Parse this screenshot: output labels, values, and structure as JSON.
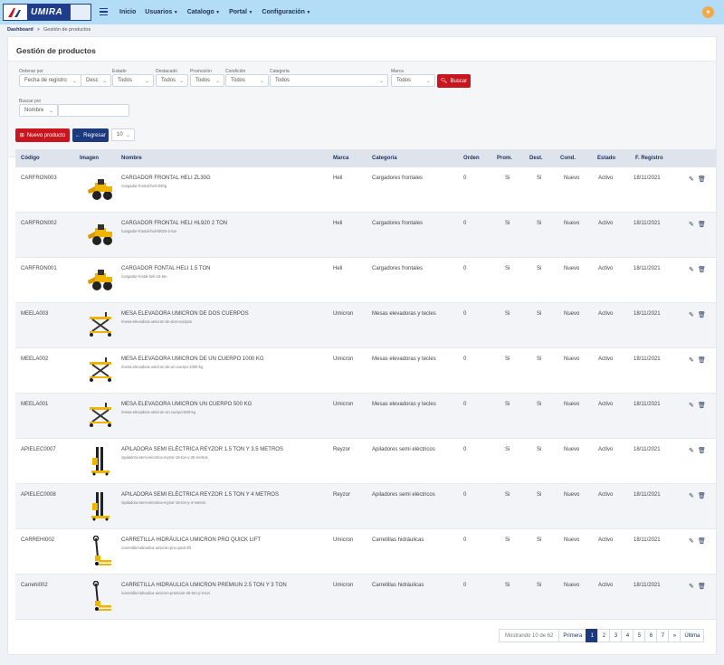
{
  "header": {
    "logo_text": "UMIRA",
    "nav": [
      {
        "label": "Inicio",
        "caret": false
      },
      {
        "label": "Usuarios",
        "caret": true
      },
      {
        "label": "Catalogo",
        "caret": true
      },
      {
        "label": "Portal",
        "caret": true
      },
      {
        "label": "Configuración",
        "caret": true
      }
    ]
  },
  "breadcrumb": {
    "home": "Dashboard",
    "sep": ">",
    "current": "Gestión de productos"
  },
  "page": {
    "title": "Gestión de productos"
  },
  "filters": {
    "ordenar": {
      "label": "Ordenar por",
      "value": "Fecha de registro"
    },
    "dir": {
      "value": "Desc"
    },
    "estado": {
      "label": "Estado",
      "value": "Todos"
    },
    "destacado": {
      "label": "Destacado",
      "value": "Todos"
    },
    "promocion": {
      "label": "Promoción",
      "value": "Todos"
    },
    "condicion": {
      "label": "Condición",
      "value": "Todos"
    },
    "categoria": {
      "label": "Categoria",
      "value": "Todos"
    },
    "marca": {
      "label": "Marca",
      "value": "Todos"
    },
    "buscar_btn": "Buscar",
    "buscar_por": {
      "label": "Buscar por",
      "value": "Nombre"
    },
    "search_value": ""
  },
  "toolbar": {
    "new_label": "Nuevo producto",
    "back_label": "Regresar",
    "page_size": "10"
  },
  "table": {
    "headers": [
      "Código",
      "Imagen",
      "Nombre",
      "Marca",
      "Categoria",
      "Orden",
      "Prom.",
      "Dest.",
      "Cond.",
      "Estado",
      "F. Registro"
    ],
    "rows": [
      {
        "codigo": "CARFRON003",
        "nombre": "CARGADOR FRONTAL HELI ZL30G",
        "slug": "/cargador-frontal-heli-zl30g",
        "marca": "Heli",
        "categoria": "Cargadores frontales",
        "orden": "0",
        "prom": "Si",
        "dest": "Si",
        "cond": "Nuevo",
        "estado": "Activo",
        "fecha": "18/11/2021",
        "img": "loader"
      },
      {
        "codigo": "CARFRON002",
        "nombre": "CARGADOR FRONTAL HELI HL920 2 TON",
        "slug": "/cargador-frontal-heli-hl920-2-ton",
        "marca": "Heli",
        "categoria": "Cargadores frontales",
        "orden": "0",
        "prom": "Si",
        "dest": "Si",
        "cond": "Nuevo",
        "estado": "Activo",
        "fecha": "18/11/2021",
        "img": "loader"
      },
      {
        "codigo": "CARFRON001",
        "nombre": "CARGADOR FONTAL HELI 1.5 TON",
        "slug": "/cargador-fontal-heli-15-ton",
        "marca": "Heli",
        "categoria": "Cargadores frontales",
        "orden": "0",
        "prom": "Si",
        "dest": "Si",
        "cond": "Nuevo",
        "estado": "Activo",
        "fecha": "18/11/2021",
        "img": "loader"
      },
      {
        "codigo": "MEELA003",
        "nombre": "MESA ELEVADORA UMICRON DE DOS CUERPOS",
        "slug": "/mesa-elevadora-umicron-de-dos-cuerpos",
        "marca": "Umicron",
        "categoria": "Mesas elevadoras y tecles",
        "orden": "0",
        "prom": "Si",
        "dest": "Si",
        "cond": "Nuevo",
        "estado": "Activo",
        "fecha": "18/11/2021",
        "img": "table"
      },
      {
        "codigo": "MEELA002",
        "nombre": "MESA ELEVADORA UMICRON DE UN CUERPO 1000 KG",
        "slug": "/mesa-elevadora-umicron-de-un-cuerpo-1000-kg",
        "marca": "Umicron",
        "categoria": "Mesas elevadoras y tecles",
        "orden": "0",
        "prom": "Si",
        "dest": "Si",
        "cond": "Nuevo",
        "estado": "Activo",
        "fecha": "18/11/2021",
        "img": "table"
      },
      {
        "codigo": "MEELA001",
        "nombre": "MESA ELEVADORA UMICRON UN CUERPO 500 KG",
        "slug": "/mesa-elevadora-umicron-un-cuerpo-500-kg",
        "marca": "Umicron",
        "categoria": "Mesas elevadoras y tecles",
        "orden": "0",
        "prom": "Si",
        "dest": "Si",
        "cond": "Nuevo",
        "estado": "Activo",
        "fecha": "18/11/2021",
        "img": "table"
      },
      {
        "codigo": "APIELEC0007",
        "nombre": "APILADORA SEMI ELÉCTRICA REYZOR 1.5 TON Y 3.5 METROS",
        "slug": "/apiladora-semi-electrica-reyzor-15-ton-y-35-metros",
        "marca": "Reyzor",
        "categoria": "Apiladores semi eléctricos",
        "orden": "0",
        "prom": "Si",
        "dest": "Si",
        "cond": "Nuevo",
        "estado": "Activo",
        "fecha": "18/11/2021",
        "img": "stacker"
      },
      {
        "codigo": "APIELEC0008",
        "nombre": "APILADORA SEMI ELÉCTRICA REYZOR 1.5 TON Y 4 METROS",
        "slug": "/apiladora-semi-electrica-reyzor-15-ton-y-4-metros",
        "marca": "Reyzor",
        "categoria": "Apiladores semi eléctricos",
        "orden": "0",
        "prom": "Si",
        "dest": "Si",
        "cond": "Nuevo",
        "estado": "Activo",
        "fecha": "18/11/2021",
        "img": "stacker"
      },
      {
        "codigo": "CARREHI002",
        "nombre": "CARRETILLA HIDRÁULICA UMICRON PRO QUICK LIFT",
        "slug": "/carretilla-hidraulica-umicron-pro-quick-lift",
        "marca": "Umicron",
        "categoria": "Carretillas hidráulicas",
        "orden": "0",
        "prom": "Si",
        "dest": "Si",
        "cond": "Nuevo",
        "estado": "Activo",
        "fecha": "18/11/2021",
        "img": "pallet"
      },
      {
        "codigo": "Carrehi002",
        "nombre": "CARRETILLA HIDRAULICA UMICRON PREMIUN 2.5 TON Y 3 TON",
        "slug": "/carretilla-hidraulica-umicron-premium-25-ton-y-3-ton",
        "marca": "Umicron",
        "categoria": "Carretillas hidráulicas",
        "orden": "0",
        "prom": "Si",
        "dest": "Si",
        "cond": "Nuevo",
        "estado": "Activo",
        "fecha": "18/11/2021",
        "img": "pallet"
      }
    ]
  },
  "pagination": {
    "info": "Mostrando 10 de 62",
    "first": "Primera",
    "pages": [
      "1",
      "2",
      "3",
      "4",
      "5",
      "6",
      "7"
    ],
    "active": "1",
    "next": "»",
    "last": "Última"
  },
  "colors": {
    "topbar": "#b3dcf6",
    "brand_blue": "#1d3a7e",
    "brand_red": "#c9151e",
    "product_yellow": "#f0b400"
  }
}
